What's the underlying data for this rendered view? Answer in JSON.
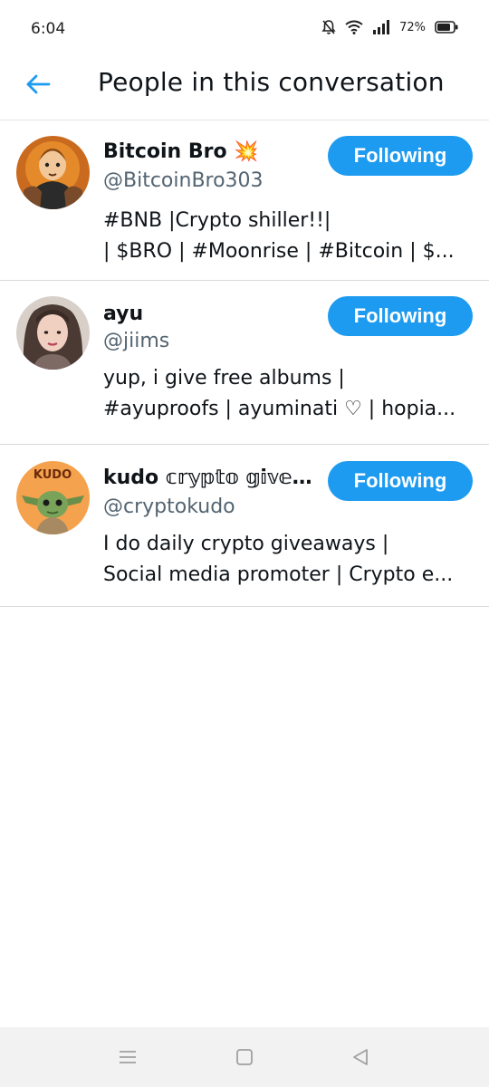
{
  "status_bar": {
    "time": "6:04",
    "battery": "72%",
    "icons": [
      "mute-bell-icon",
      "wifi-icon",
      "signal-icon",
      "battery-icon"
    ]
  },
  "header": {
    "title": "People in this conversation",
    "back_icon": "arrow-left-icon"
  },
  "colors": {
    "accent": "#1d9bf0",
    "text": "#0f1419",
    "secondary": "#536471"
  },
  "users": [
    {
      "name": "Bitcoin Bro 💥",
      "handle": "@BitcoinBro303",
      "bio_lines": [
        "#BNB |Crypto shiller!!|",
        " | $BRO | #Moonrise | #Bitcoin | $..."
      ],
      "button": "Following"
    },
    {
      "name": "ayu",
      "handle": "@jiims",
      "bio_lines": [
        "yup, i give free albums |",
        "#ayuproofs | ayuminati ♡ | hopia..."
      ],
      "button": "Following"
    },
    {
      "name": "kudo 𝕔𝕣𝕪𝕡𝕥𝕠 𝕘𝕚𝕧𝕖𝕒...",
      "handle": "@cryptokudo",
      "bio_lines": [
        "I do daily crypto giveaways |",
        "Social media promoter | Crypto e..."
      ],
      "avatar_text": "KUDO",
      "button": "Following"
    }
  ],
  "nav_bar": {
    "icons": [
      "menu-icon",
      "home-square-icon",
      "back-triangle-icon"
    ]
  }
}
